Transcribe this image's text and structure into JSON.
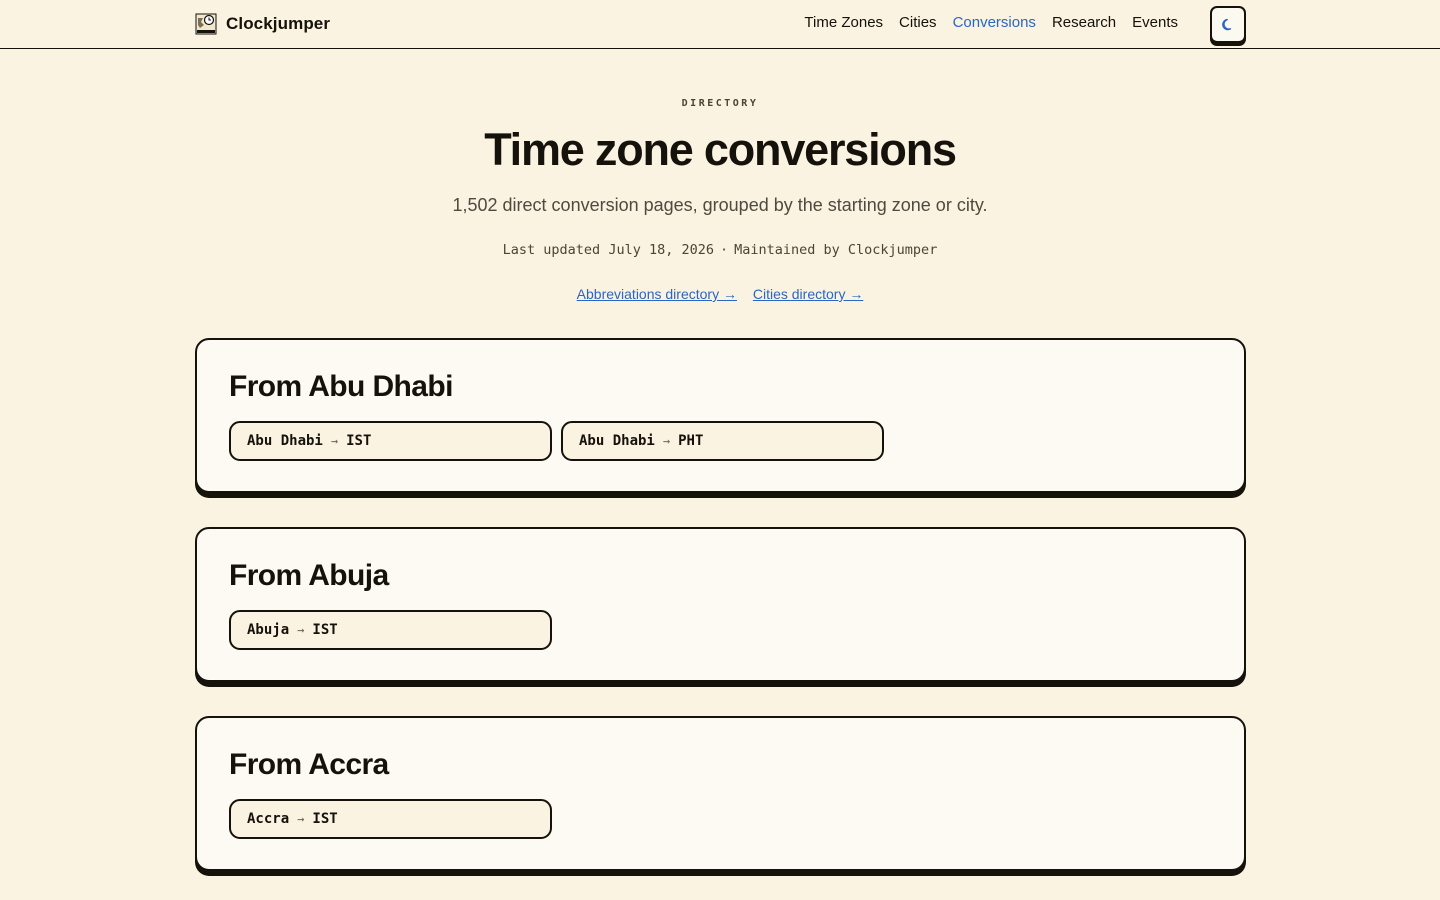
{
  "brand": {
    "name": "Clockjumper",
    "logo_icon": "clock-map-logo-icon"
  },
  "nav": {
    "items": [
      {
        "label": "Time Zones",
        "active": false
      },
      {
        "label": "Cities",
        "active": false
      },
      {
        "label": "Conversions",
        "active": true
      },
      {
        "label": "Research",
        "active": false
      },
      {
        "label": "Events",
        "active": false
      }
    ],
    "theme_toggle_icon": "moon-icon"
  },
  "hero": {
    "eyebrow": "DIRECTORY",
    "title": "Time zone conversions",
    "subtitle": "1,502 direct conversion pages, grouped by the starting zone or city.",
    "updated": "Last updated July 18, 2026",
    "separator": "·",
    "maintained": "Maintained by Clockjumper",
    "links": [
      {
        "label": "Abbreviations directory →"
      },
      {
        "label": "Cities directory →"
      }
    ]
  },
  "arrow_glyph": "→",
  "groups": [
    {
      "heading": "From Abu Dhabi",
      "conversions": [
        {
          "from": "Abu Dhabi",
          "to": "IST"
        },
        {
          "from": "Abu Dhabi",
          "to": "PHT"
        }
      ]
    },
    {
      "heading": "From Abuja",
      "conversions": [
        {
          "from": "Abuja",
          "to": "IST"
        }
      ]
    },
    {
      "heading": "From Accra",
      "conversions": [
        {
          "from": "Accra",
          "to": "IST"
        }
      ]
    }
  ],
  "colors": {
    "background": "#faf3e1",
    "card": "#fcfaf2",
    "ink": "#15120c",
    "link": "#2a66c4"
  }
}
